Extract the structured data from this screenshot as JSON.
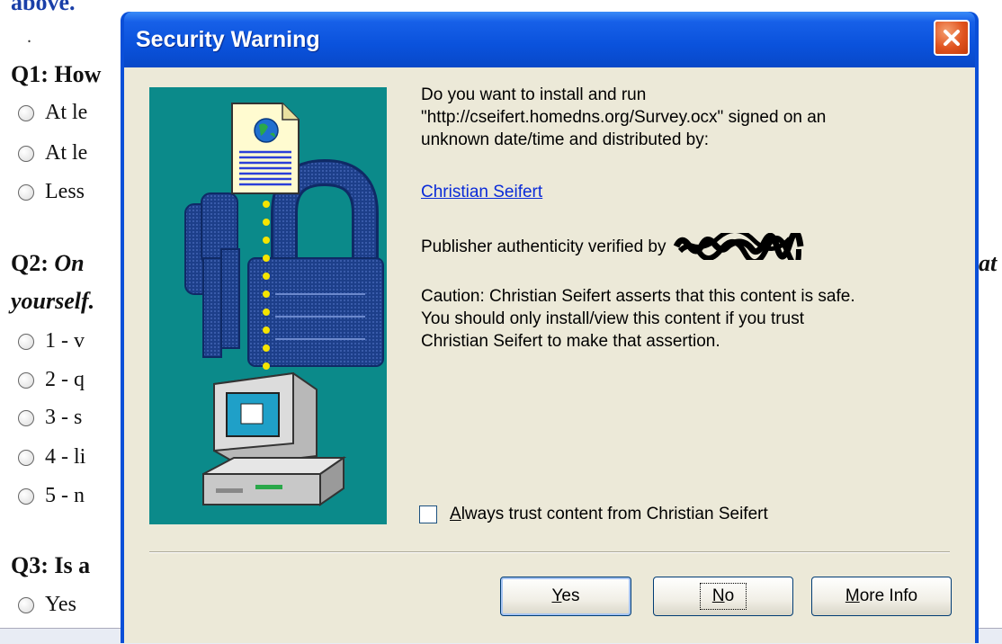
{
  "background_page": {
    "intro_text": "above.",
    "dot": ".",
    "q1": {
      "label": "Q1:",
      "text": "How",
      "options": [
        "At le",
        "At le",
        "Less"
      ]
    },
    "q2": {
      "label": "Q2:",
      "text": "On",
      "trailing": "at",
      "line2": "yourself.",
      "options": [
        "1 - v",
        "2 - q",
        "3 - s",
        "4 - li",
        "5 - n"
      ]
    },
    "q3": {
      "label": "Q3:",
      "text": "Is a",
      "options": [
        "Yes"
      ]
    }
  },
  "dialog": {
    "title": "Security Warning",
    "close_icon": "close-x-icon",
    "illustration_icons": [
      "document-globe-icon",
      "padlock-keys-icon",
      "computer-icon"
    ],
    "message": {
      "line1": "Do you want to install and run",
      "line2": "\"http://cseifert.homedns.org/Survey.ocx\" signed on an",
      "line3": "unknown date/time and distributed by:"
    },
    "publisher_link": "Christian Seifert",
    "authenticity_text": "Publisher authenticity verified by",
    "caution": {
      "line1": "Caution: Christian Seifert asserts that this content is safe.",
      "line2": "You should only install/view this content if you trust",
      "line3": "Christian Seifert to make that assertion."
    },
    "always_trust": {
      "checked": false,
      "mnemonic": "A",
      "rest": "lways trust content from Christian Seifert"
    },
    "buttons": {
      "yes": {
        "mnemonic": "Y",
        "rest": "es"
      },
      "no": {
        "mnemonic": "N",
        "rest": "o"
      },
      "more": {
        "mnemonic": "M",
        "rest": "ore Info"
      }
    },
    "colors": {
      "titlebar": "#0a52dc",
      "client": "#ece9d8",
      "art_bg": "#0b8a8a",
      "link": "#0a2bd8",
      "close": "#e0531f"
    }
  }
}
